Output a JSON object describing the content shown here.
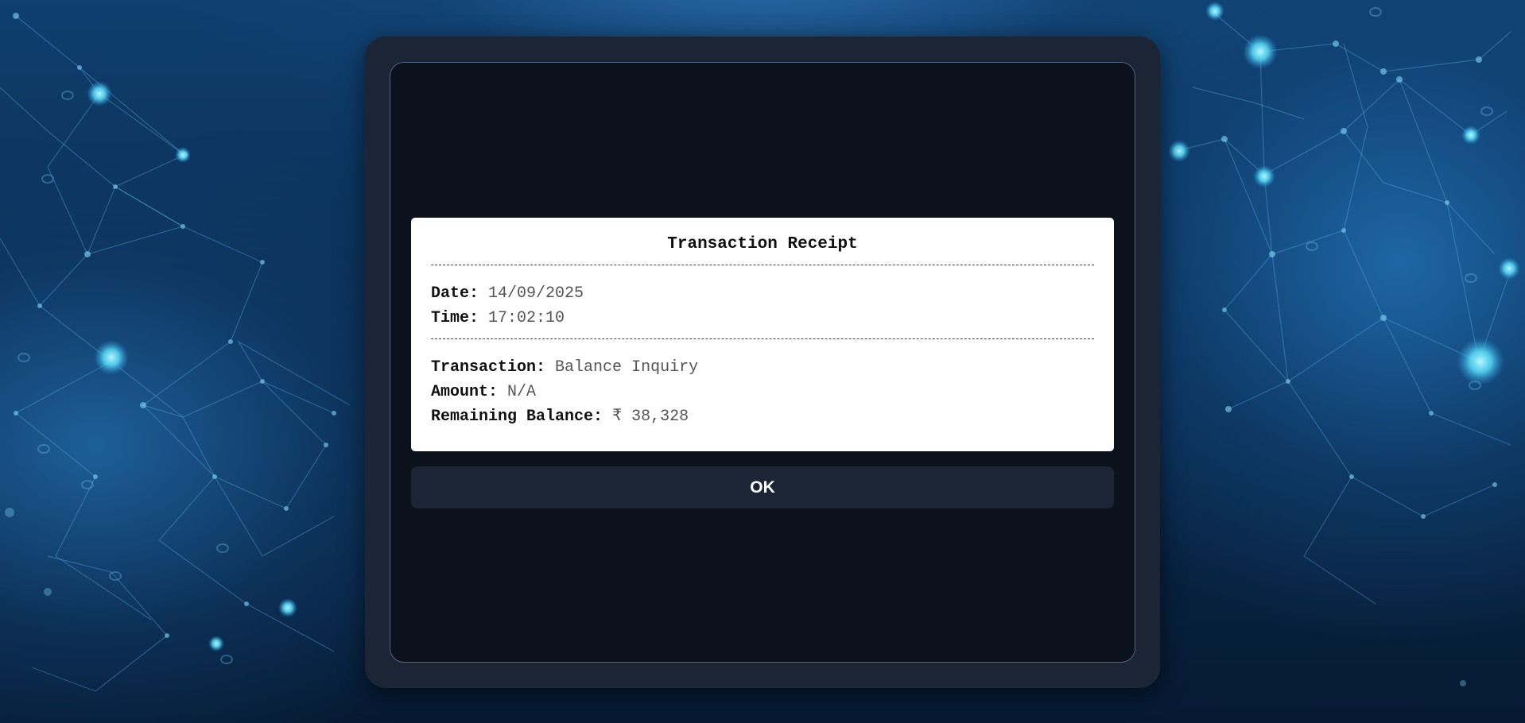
{
  "receipt": {
    "title": "Transaction Receipt",
    "date_label": "Date:",
    "date_value": "14/09/2025",
    "time_label": "Time:",
    "time_value": "17:02:10",
    "transaction_label": "Transaction:",
    "transaction_value": "Balance Inquiry",
    "amount_label": "Amount:",
    "amount_value": "N/A",
    "balance_label": "Remaining Balance:",
    "balance_value": "₹ 38,328"
  },
  "actions": {
    "ok_label": "OK"
  },
  "colors": {
    "background": "#0a2c52",
    "frame": "#1b2536",
    "screen": "#0c121c",
    "button": "#1c2536",
    "receipt": "#ffffff",
    "network_glow": "#4fd6f0"
  }
}
